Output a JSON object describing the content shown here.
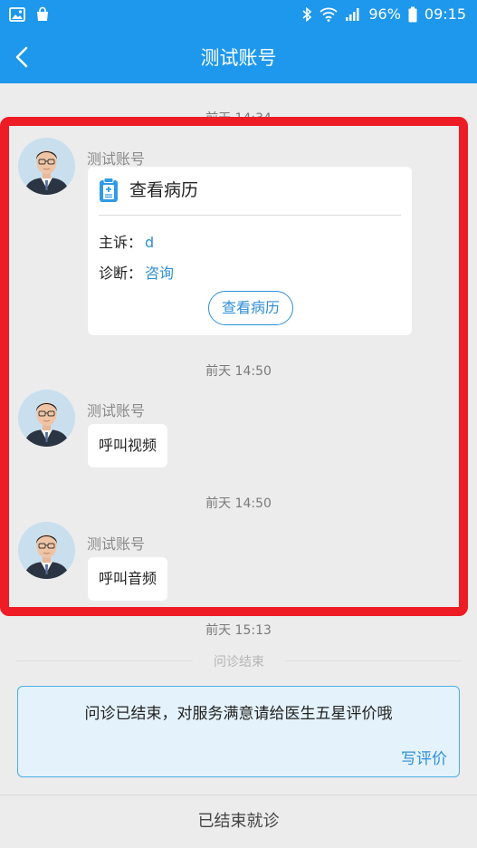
{
  "status_bar": {
    "battery": "96%",
    "time": "09:15"
  },
  "header": {
    "title": "测试账号"
  },
  "messages": {
    "t0": "前天 14:34",
    "card_sender": "测试账号",
    "card_title": "查看病历",
    "complaint_label": "主诉：",
    "complaint_value": "d",
    "diagnosis_label": "诊断：",
    "diagnosis_value": "咨询",
    "card_button": "查看病历",
    "t1": "前天 14:50",
    "video_sender": "测试账号",
    "video_text": "呼叫视频",
    "t2": "前天 14:50",
    "audio_sender": "测试账号",
    "audio_text": "呼叫音频",
    "t3": "前天 15:13"
  },
  "divider_text": "问诊结束",
  "notice": {
    "message": "问诊已结束，对服务满意请给医生五星评价哦",
    "link": "写评价"
  },
  "bottom": {
    "label": "已结束就诊"
  },
  "colors": {
    "primary": "#1e98ec",
    "highlight_frame": "#ee1c24",
    "link": "#2f8fd8"
  }
}
